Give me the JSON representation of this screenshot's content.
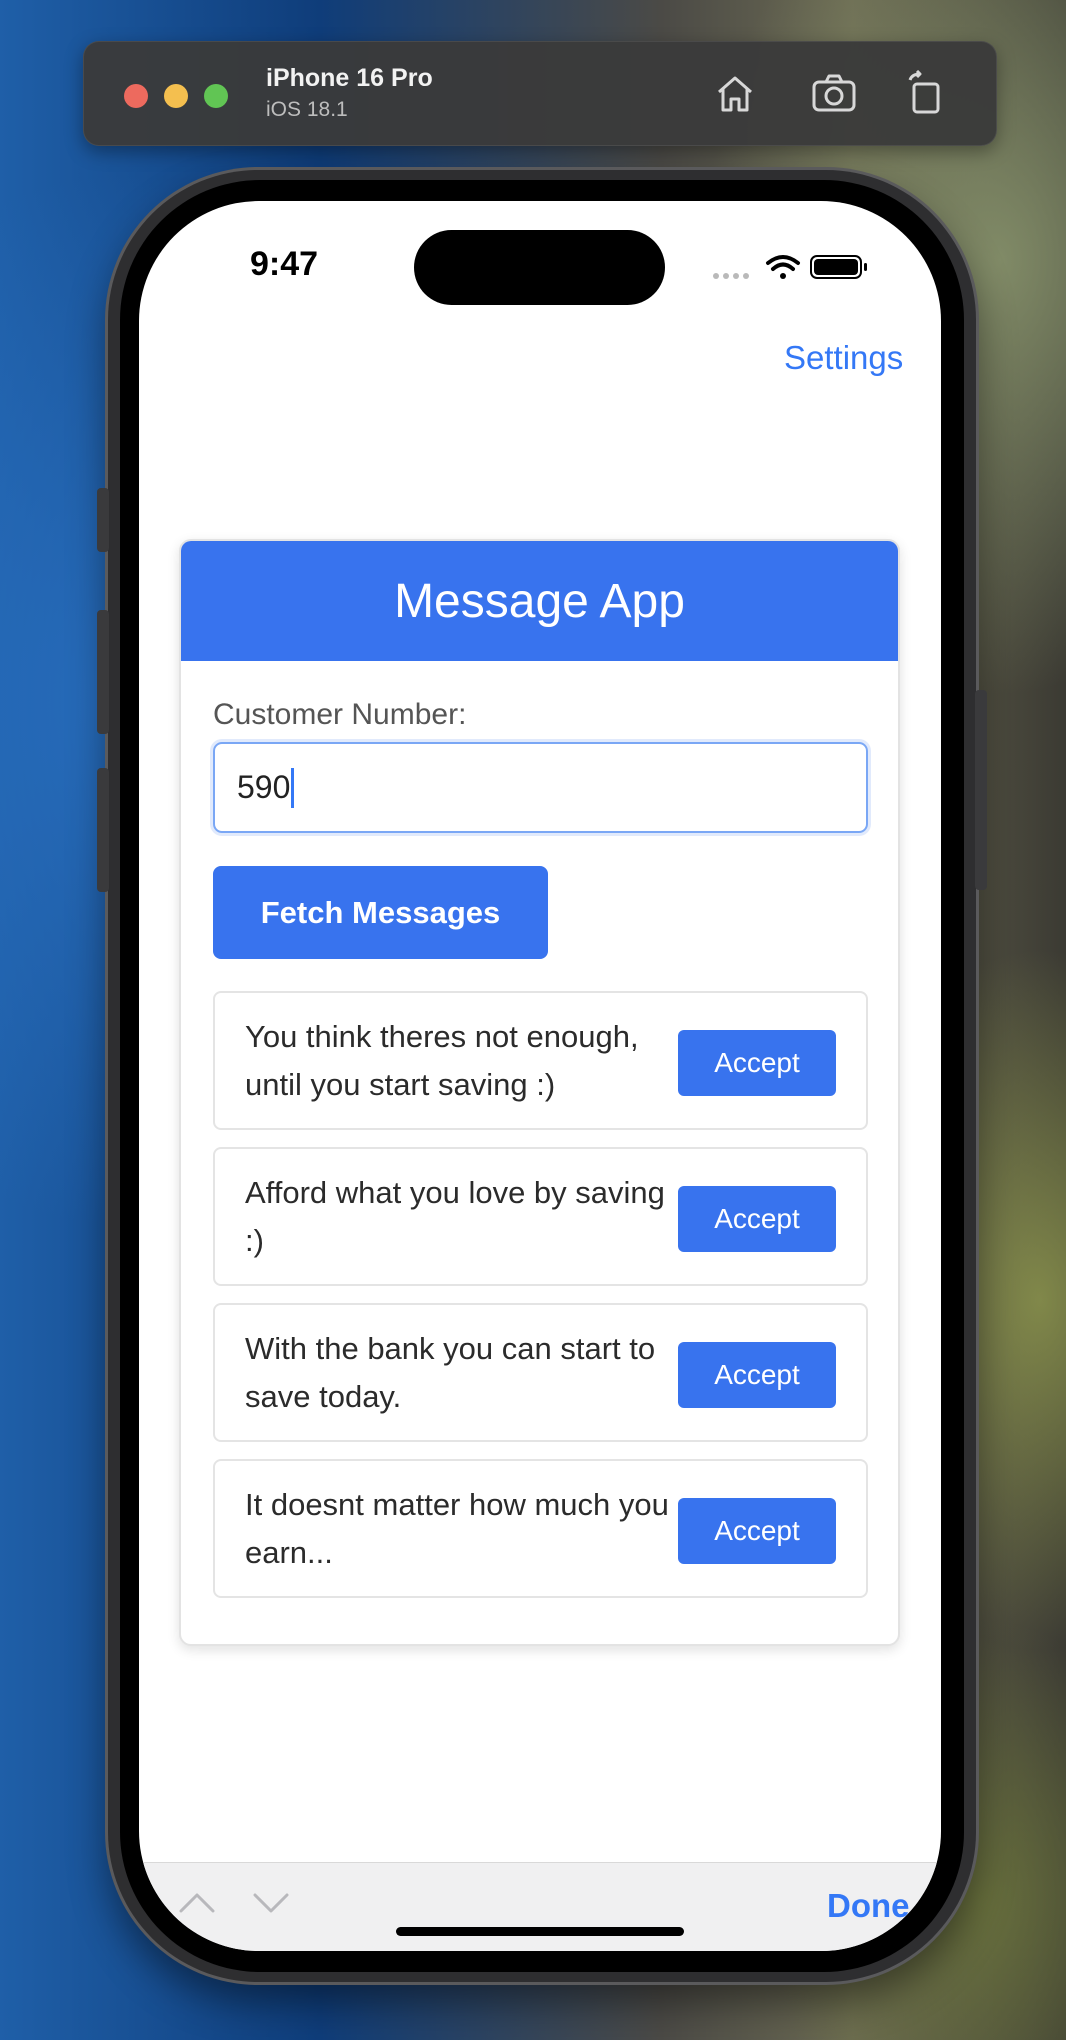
{
  "simulator": {
    "device": "iPhone 16 Pro",
    "os": "iOS 18.1",
    "icons": [
      "home-icon",
      "screenshot-icon",
      "rotate-icon"
    ]
  },
  "status_bar": {
    "time": "9:47",
    "icons": [
      "signal-icon",
      "wifi-icon",
      "battery-icon"
    ]
  },
  "nav": {
    "settings_label": "Settings"
  },
  "app": {
    "title": "Message App",
    "customer_label": "Customer Number:",
    "customer_value": "590",
    "fetch_label": "Fetch Messages",
    "messages": [
      {
        "text": "You think theres not enough, until you start saving :)",
        "action": "Accept"
      },
      {
        "text": "Afford what you love by saving :)",
        "action": "Accept"
      },
      {
        "text": "With the bank you can start to save today.",
        "action": "Accept"
      },
      {
        "text": "It doesnt matter how much you earn...",
        "action": "Accept"
      }
    ]
  },
  "accessory": {
    "done_label": "Done",
    "icons": [
      "chevron-up-icon",
      "chevron-down-icon"
    ]
  },
  "colors": {
    "accent": "#3873ee",
    "link": "#3478f6"
  }
}
